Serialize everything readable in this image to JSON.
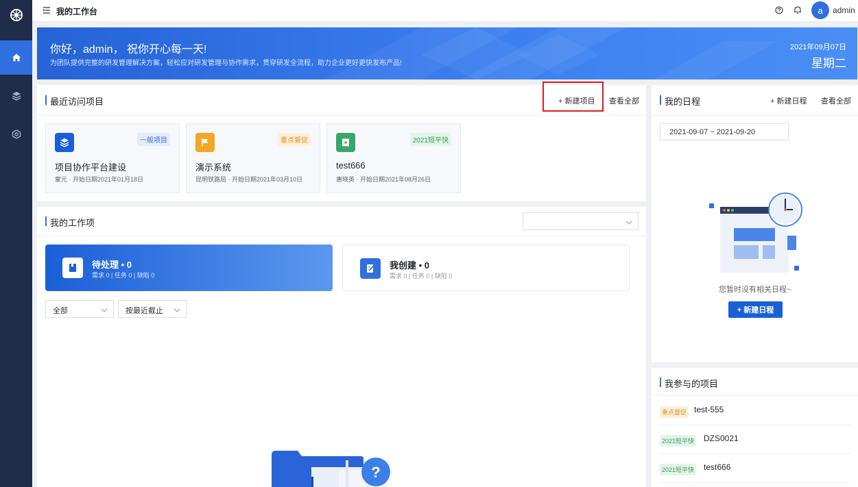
{
  "header": {
    "title": "我的工作台",
    "user": "admin",
    "avatar_letter": "a"
  },
  "sidebar": {
    "items": [
      "logo-icon",
      "home-icon",
      "layers-icon",
      "hexagon-settings-icon"
    ],
    "active": "home-icon"
  },
  "banner": {
    "greeting": "你好，admin，  祝你开心每一天!",
    "subtitle": "为团队提供完整的研发管理解决方案，轻松应对研发管理与协作需求，贯穿研发全流程，助力企业更好更快发布产品!",
    "date": "2021年09月07日",
    "weekday": "星期二"
  },
  "recent": {
    "title": "最近访问项目",
    "new_label": "+ 新建项目",
    "all_label": "查看全部",
    "projects": [
      {
        "name": "项目协作平台建设",
        "tag": "一般项目",
        "meta": "蒙元 · 开始日期2021年01月18日",
        "color": "#1a5fd6"
      },
      {
        "name": "演示系统",
        "tag": "重点督促",
        "meta": "昆明铁路局 · 开始日期2021年03月10日",
        "color": "#f5a623"
      },
      {
        "name": "test666",
        "tag": "2021短平快",
        "meta": "惠晓英 · 开始日期2021年08月26日",
        "color": "#3aa66a"
      }
    ]
  },
  "work": {
    "title": "我的工作项",
    "pending": {
      "title": "待处理 • 0",
      "sub": "需求 0 | 任务 0 | 缺陷 0"
    },
    "created": {
      "title": "我创建 • 0",
      "sub": "需求 0 | 任务 0 | 缺陷 0"
    },
    "filter_all": "全部",
    "filter_sort": "按最近截止"
  },
  "schedule": {
    "title": "我的日程",
    "new_label": "+ 新建日程",
    "all_label": "查看全部",
    "range": "2021-09-07  ~  2021-09-20",
    "empty_text": "您暂时没有相关日程~",
    "button_label": "+ 新建日程"
  },
  "participated": {
    "title": "我参与的项目",
    "items": [
      {
        "tag": "重点督促",
        "name": "test-555"
      },
      {
        "tag": "2021短平快",
        "name": "DZS0021"
      },
      {
        "tag": "2021短平快",
        "name": "test666"
      }
    ]
  },
  "colors": {
    "accent": "#1a5fd6",
    "sidebar": "#1f2d4a",
    "highlight_box": "#e11b1b"
  }
}
